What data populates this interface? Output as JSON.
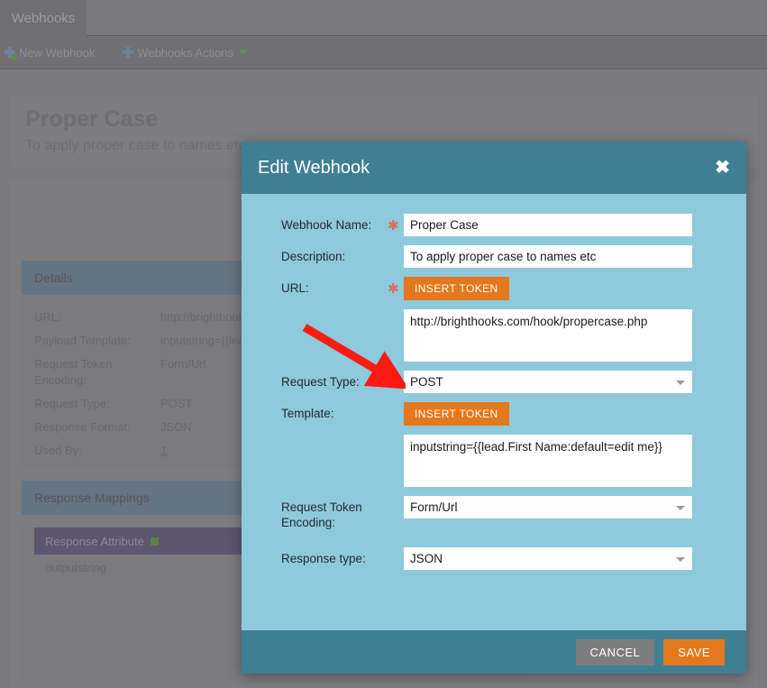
{
  "tabs": [
    {
      "label": "Webhooks"
    }
  ],
  "toolbar": {
    "new_webhook_label": "New Webhook",
    "actions_label": "Webhooks Actions"
  },
  "page_header": {
    "title": "Proper Case",
    "subtitle": "To apply proper case to names etc"
  },
  "details_panel": {
    "heading": "Details",
    "rows": [
      {
        "key": "URL:",
        "value": "http://brighthooks.com/hook/propercase.php"
      },
      {
        "key": "Payload Template:",
        "value": "inputstring={{lead.First Name:default=edit me}}"
      },
      {
        "key": "Request Token Encoding:",
        "value": "Form/Url"
      },
      {
        "key": "Request Type:",
        "value": "POST"
      },
      {
        "key": "Response Format:",
        "value": "JSON"
      },
      {
        "key": "Used By:",
        "value": "1"
      }
    ]
  },
  "mappings_panel": {
    "heading": "Response Mappings",
    "column_header": "Response Attribute",
    "rows": [
      {
        "attribute": "outputstring"
      }
    ]
  },
  "modal": {
    "title": "Edit Webhook",
    "close_label": "✖",
    "fields": {
      "webhook_name": {
        "label": "Webhook Name:",
        "value": "Proper Case",
        "required": "✱"
      },
      "description": {
        "label": "Description:",
        "value": "To apply proper case to names etc"
      },
      "url": {
        "label": "URL:",
        "required": "✱",
        "token_button": "INSERT TOKEN",
        "value": "http://brighthooks.com/hook/propercase.php"
      },
      "request_type": {
        "label": "Request Type:",
        "required": "✱",
        "value": "POST"
      },
      "template": {
        "label": "Template:",
        "token_button": "INSERT TOKEN",
        "value": "inputstring={{lead.First Name:default=edit me}}"
      },
      "request_token_encoding": {
        "label": "Request Token Encoding:",
        "value": "Form/Url"
      },
      "response_type": {
        "label": "Response type:",
        "value": "JSON"
      }
    },
    "buttons": {
      "cancel": "CANCEL",
      "save": "SAVE"
    }
  },
  "colors": {
    "modal_header": "#3e7f94",
    "modal_body": "#8fc9dc",
    "accent_orange": "#e5781d",
    "required_star": "#e0685f",
    "annotation_arrow": "#fc1b11",
    "page_dim": "#7a7a7e"
  }
}
